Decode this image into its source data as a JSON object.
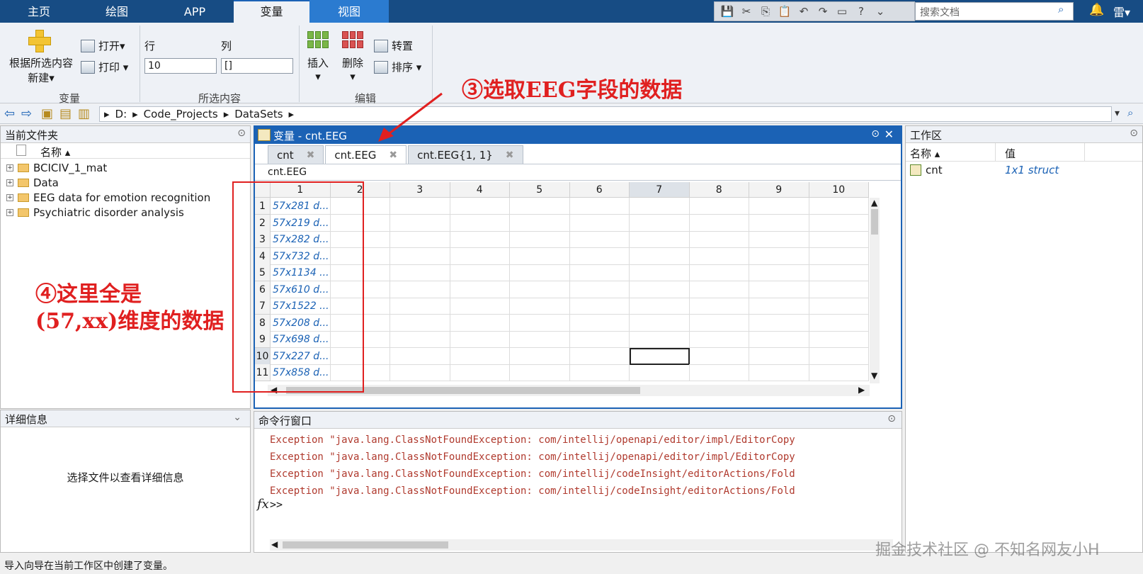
{
  "tabs": [
    "主页",
    "绘图",
    "APP",
    "变量",
    "视图"
  ],
  "search": {
    "placeholder": "搜索文档"
  },
  "user": "雷▾",
  "toolstrip": {
    "new_from_selection_line1": "根据所选内容",
    "new_from_selection_line2": "新建▾",
    "open": "打开▾",
    "print": "打印 ▾",
    "row_label": "行",
    "col_label": "列",
    "row_value": "10",
    "col_value": "[]",
    "insert": "插入",
    "delete": "删除",
    "transpose": "转置",
    "sort": "排序 ▾",
    "group_variable": "变量",
    "group_selection": "所选内容",
    "group_edit": "编辑"
  },
  "address": {
    "parts": [
      "D:",
      "Code_Projects",
      "DataSets"
    ]
  },
  "current_folder": {
    "title": "当前文件夹",
    "name_header": "名称 ▴",
    "items": [
      "BCICIV_1_mat",
      "Data",
      "EEG data for emotion recognition",
      "Psychiatric disorder analysis"
    ]
  },
  "details": {
    "title": "详细信息",
    "empty_text": "选择文件以查看详细信息"
  },
  "variable_editor": {
    "title": "变量 - cnt.EEG",
    "tabs": [
      "cnt",
      "cnt.EEG",
      "cnt.EEG{1, 1}"
    ],
    "breadcrumb": "cnt.EEG",
    "columns": [
      "1",
      "2",
      "3",
      "4",
      "5",
      "6",
      "7",
      "8",
      "9",
      "10"
    ],
    "rows": [
      {
        "n": "1",
        "v": "57x281 d..."
      },
      {
        "n": "2",
        "v": "57x219 d..."
      },
      {
        "n": "3",
        "v": "57x282 d..."
      },
      {
        "n": "4",
        "v": "57x732 d..."
      },
      {
        "n": "5",
        "v": "57x1134 ..."
      },
      {
        "n": "6",
        "v": "57x610 d..."
      },
      {
        "n": "7",
        "v": "57x1522 ..."
      },
      {
        "n": "8",
        "v": "57x208 d..."
      },
      {
        "n": "9",
        "v": "57x698 d..."
      },
      {
        "n": "10",
        "v": "57x227 d..."
      },
      {
        "n": "11",
        "v": "57x858 d..."
      }
    ]
  },
  "command_window": {
    "title": "命令行窗口",
    "lines": [
      "Exception \"java.lang.ClassNotFoundException: com/intellij/openapi/editor/impl/EditorCopy",
      "Exception \"java.lang.ClassNotFoundException: com/intellij/openapi/editor/impl/EditorCopy",
      "Exception \"java.lang.ClassNotFoundException: com/intellij/codeInsight/editorActions/Fold",
      "Exception \"java.lang.ClassNotFoundException: com/intellij/codeInsight/editorActions/Fold"
    ],
    "prompt": ">>",
    "fx": "fx"
  },
  "workspace": {
    "title": "工作区",
    "name_header": "名称 ▴",
    "value_header": "值",
    "vars": [
      {
        "name": "cnt",
        "value": "1x1 struct"
      }
    ]
  },
  "status": "导入向导在当前工作区中创建了变量。",
  "annotations": {
    "a3": "③选取EEG字段的数据",
    "a4_line1": "④这里全是",
    "a4_line2": "(57,xx)维度的数据"
  },
  "watermark": "掘金技术社区 @ 不知名网友小H"
}
